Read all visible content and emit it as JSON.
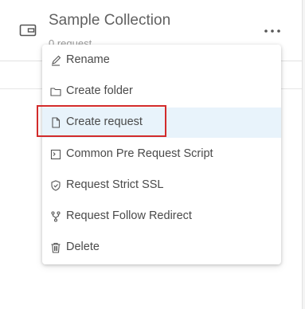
{
  "collection": {
    "title": "Sample Collection",
    "subtitle": "0 request",
    "icon": "collection-icon",
    "more_icon": "more-horizontal-icon"
  },
  "context_menu": {
    "items": [
      {
        "label": "Rename",
        "icon": "edit-icon"
      },
      {
        "label": "Create folder",
        "icon": "folder-icon"
      },
      {
        "label": "Create request",
        "icon": "file-icon",
        "highlighted": true
      },
      {
        "label": "Common Pre Request Script",
        "icon": "terminal-icon"
      },
      {
        "label": "Request Strict SSL",
        "icon": "shield-icon"
      },
      {
        "label": "Request Follow Redirect",
        "icon": "fork-icon"
      },
      {
        "label": "Delete",
        "icon": "trash-icon"
      }
    ]
  },
  "colors": {
    "highlight_bg": "#e8f3fb",
    "annotation_border": "#d22b2b",
    "title_text": "#616161",
    "menu_text": "#4a4a4a"
  }
}
